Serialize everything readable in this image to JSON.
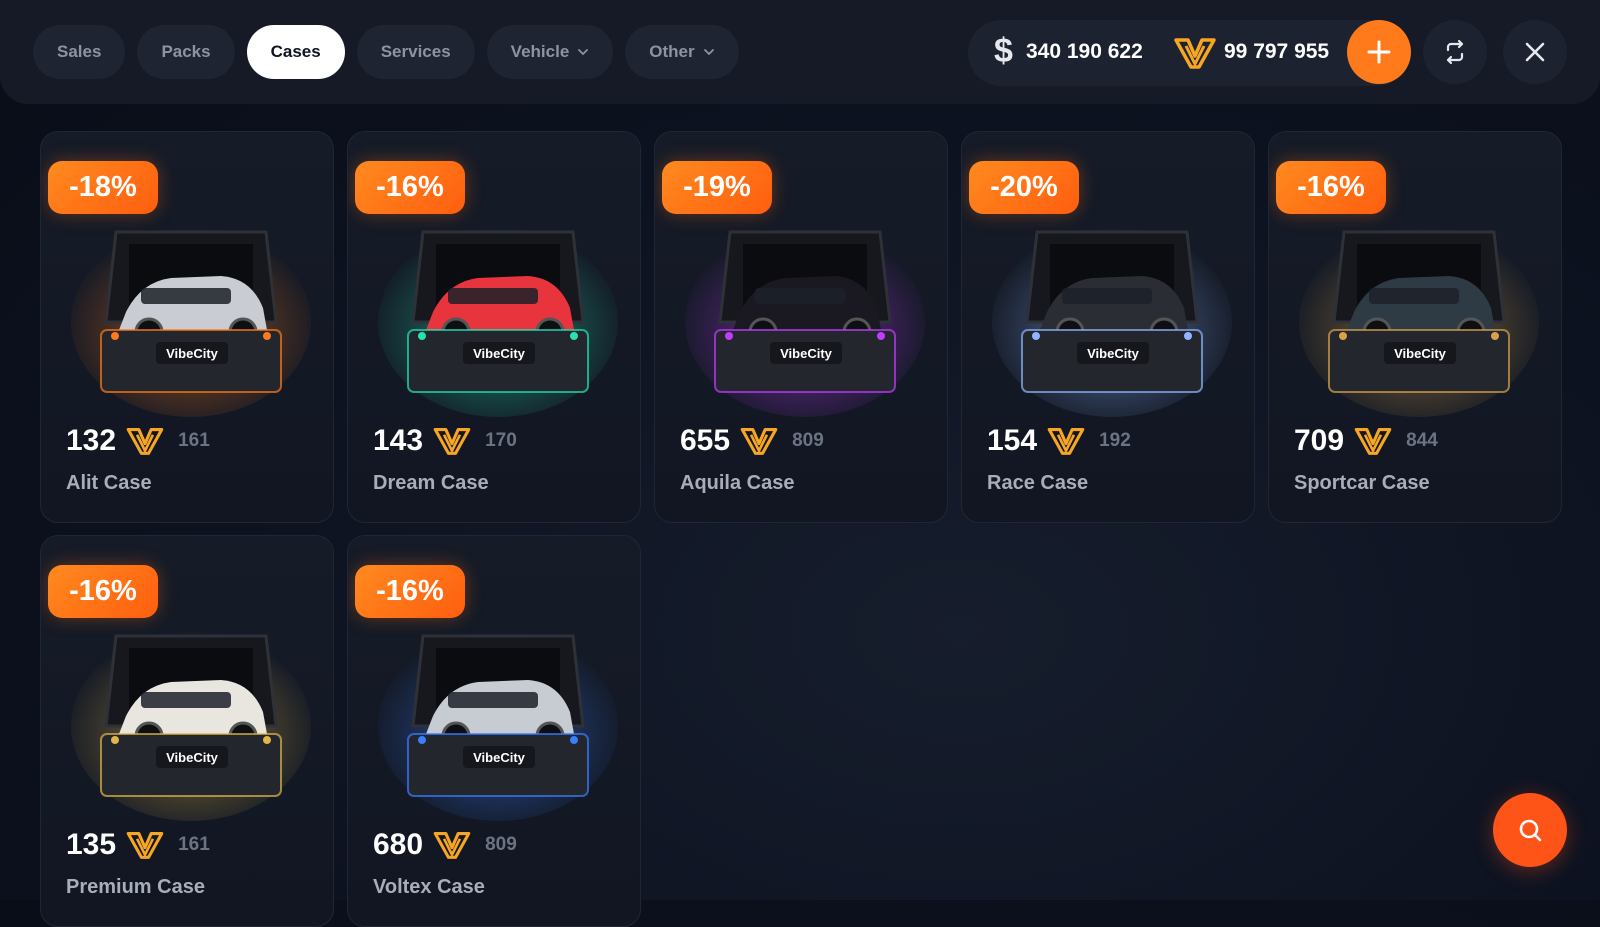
{
  "nav": {
    "tabs": [
      {
        "label": "Sales"
      },
      {
        "label": "Packs"
      },
      {
        "label": "Cases",
        "active": true
      },
      {
        "label": "Services"
      },
      {
        "label": "Vehicle",
        "dropdown": true
      },
      {
        "label": "Other",
        "dropdown": true
      }
    ]
  },
  "balance": {
    "currency_symbol": "$",
    "cash": "340 190 622",
    "coins": "99 797 955",
    "coin_icon": "vibecity-v-coin-icon"
  },
  "actions": {
    "add_icon": "plus-icon",
    "refresh_icon": "refresh-icon",
    "close_icon": "close-icon",
    "search_icon": "search-icon"
  },
  "colors": {
    "accent": "#ff7a1a",
    "coin_gold": "#f6a623",
    "background": "#0d1220"
  },
  "cases": [
    {
      "discount": "-18%",
      "price": "132",
      "old_price": "161",
      "name": "Alit Case",
      "glow": "#ff7a1a",
      "car": "#c9ccd2"
    },
    {
      "discount": "-16%",
      "price": "143",
      "old_price": "170",
      "name": "Dream Case",
      "glow": "#24e3b2",
      "car": "#e8343d"
    },
    {
      "discount": "-19%",
      "price": "655",
      "old_price": "809",
      "name": "Aquila Case",
      "glow": "#c13cff",
      "car": "#1a1820"
    },
    {
      "discount": "-20%",
      "price": "154",
      "old_price": "192",
      "name": "Race Case",
      "glow": "#8fb6ff",
      "car": "#2a2d33"
    },
    {
      "discount": "-16%",
      "price": "709",
      "old_price": "844",
      "name": "Sportcar Case",
      "glow": "#d8a24a",
      "car": "#2f3b44"
    },
    {
      "discount": "-16%",
      "price": "135",
      "old_price": "161",
      "name": "Premium Case",
      "glow": "#e0b648",
      "car": "#e9e6e0"
    },
    {
      "discount": "-16%",
      "price": "680",
      "old_price": "809",
      "name": "Voltex Case",
      "glow": "#3b7dff",
      "car": "#c7cbd2"
    }
  ],
  "case_logo_text": "VibeCity"
}
